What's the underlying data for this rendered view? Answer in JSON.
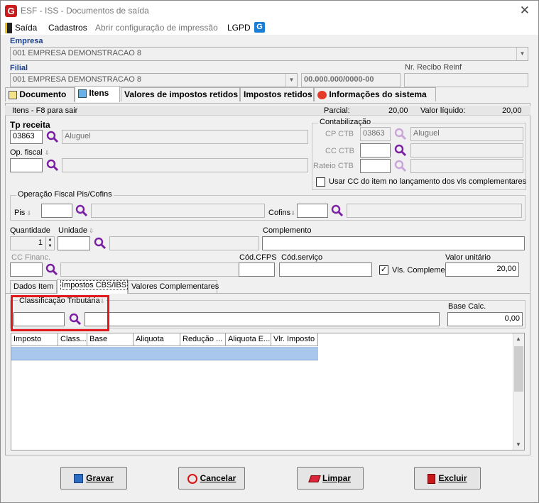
{
  "window": {
    "title": "ESF - ISS - Documentos de saída",
    "logo_letter": "G",
    "close_glyph": "✕"
  },
  "menu": {
    "items": [
      "Saída",
      "Cadastros",
      "Abrir configuração de impressão",
      "LGPD"
    ]
  },
  "empresa": {
    "label": "Empresa",
    "value": "001 EMPRESA DEMONSTRACAO 8"
  },
  "filial": {
    "label": "Filial",
    "value": "001 EMPRESA DEMONSTRACAO 8",
    "cnpj": "00.000.000/0000-00",
    "recibo_label": "Nr. Recibo Reinf",
    "recibo_value": ""
  },
  "tabs": [
    "Documento",
    "Itens",
    "Valores de impostos retidos",
    "Impostos retidos",
    "Informações do sistema"
  ],
  "status": {
    "left": "Itens - F8 para sair",
    "parcial_label": "Parcial:",
    "parcial_value": "20,00",
    "liquido_label": "Valor líquido:",
    "liquido_value": "20,00"
  },
  "tp_receita": {
    "label": "Tp receita",
    "code": "03863",
    "desc": "Aluguel"
  },
  "op_fiscal": {
    "label": "Op. fiscal",
    "code": "",
    "desc": ""
  },
  "contabilizacao": {
    "title": "Contabilização",
    "cp_ctb_label": "CP CTB",
    "cp_ctb_code": "03863",
    "cp_ctb_desc": "Aluguel",
    "cc_ctb_label": "CC CTB",
    "rateio_label": "Rateio CTB",
    "usar_cc_label": "Usar CC do item no lançamento dos vls complementares"
  },
  "pis_cofins": {
    "title": "Operação Fiscal Pis/Cofins",
    "pis_label": "Pis",
    "cofins_label": "Cofins"
  },
  "quantidade": {
    "label": "Quantidade",
    "value": "1"
  },
  "unidade": {
    "label": "Unidade"
  },
  "complemento": {
    "label": "Complemento",
    "value": ""
  },
  "cc_financ": {
    "label": "CC Financ."
  },
  "cod_cfps": {
    "label": "Cód.CFPS"
  },
  "cod_servico": {
    "label": "Cód.serviço"
  },
  "vls_complementares": {
    "label": "Vls. Complementares",
    "checked": true
  },
  "valor_unitario": {
    "label": "Valor unitário",
    "value": "20,00"
  },
  "subtabs": [
    "Dados Item",
    "Impostos CBS/IBS",
    "Valores Complementares"
  ],
  "classificacao": {
    "label": "Classificação Tributária",
    "code": "",
    "desc": ""
  },
  "base_calc": {
    "label": "Base Calc.",
    "value": "0,00"
  },
  "grid": {
    "columns": [
      "Imposto",
      "Class...",
      "Base",
      "Aliquota",
      "Redução ...",
      "Aliquota E...",
      "Vlr. Imposto"
    ]
  },
  "buttons": {
    "gravar": "Gravar",
    "cancelar": "Cancelar",
    "limpar": "Limpar",
    "excluir": "Excluir"
  },
  "colors": {
    "highlight": "#e3161c",
    "row_selected": "#a9c7ec",
    "search_icon": "#7b1fa2"
  }
}
